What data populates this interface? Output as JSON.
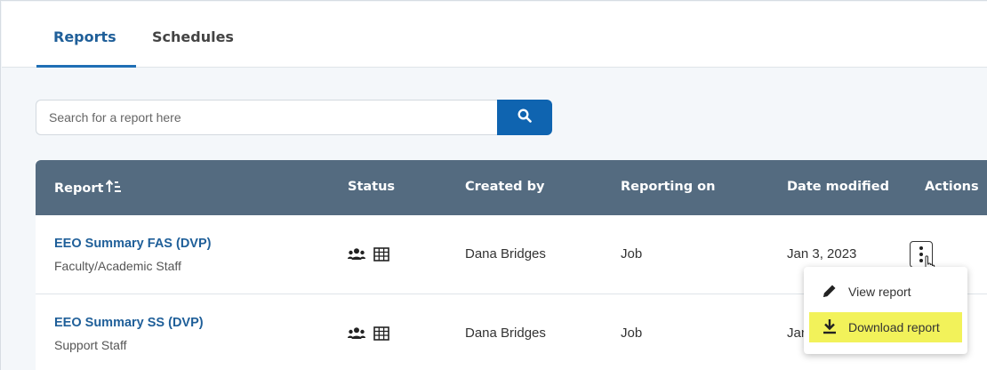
{
  "tabs": [
    {
      "label": "Reports",
      "active": true
    },
    {
      "label": "Schedules",
      "active": false
    }
  ],
  "search": {
    "placeholder": "Search for a report here",
    "button_icon": "search-icon"
  },
  "table": {
    "columns": [
      "Report",
      "Status",
      "Created by",
      "Reporting on",
      "Date modified",
      "Actions"
    ],
    "sort_icon": "sort-ascending-icon",
    "rows": [
      {
        "title": "EEO Summary FAS (DVP)",
        "subtitle": "Faculty/Academic Staff",
        "status_icons": [
          "group-icon",
          "table-icon"
        ],
        "created_by": "Dana Bridges",
        "reporting_on": "Job",
        "date_modified": "Jan 3, 2023"
      },
      {
        "title": "EEO Summary SS (DVP)",
        "subtitle": "Support Staff",
        "status_icons": [
          "group-icon",
          "table-icon"
        ],
        "created_by": "Dana Bridges",
        "reporting_on": "Job",
        "date_modified": "Jan"
      }
    ]
  },
  "actions_menu": {
    "items": [
      {
        "label": "View report",
        "icon": "pencil-icon",
        "highlighted": false
      },
      {
        "label": "Download report",
        "icon": "download-icon",
        "highlighted": true
      }
    ]
  },
  "colors": {
    "accent": "#1f5f99",
    "header_bg": "#546b80",
    "search_button": "#0f64b0",
    "highlight": "#f2f25a"
  }
}
